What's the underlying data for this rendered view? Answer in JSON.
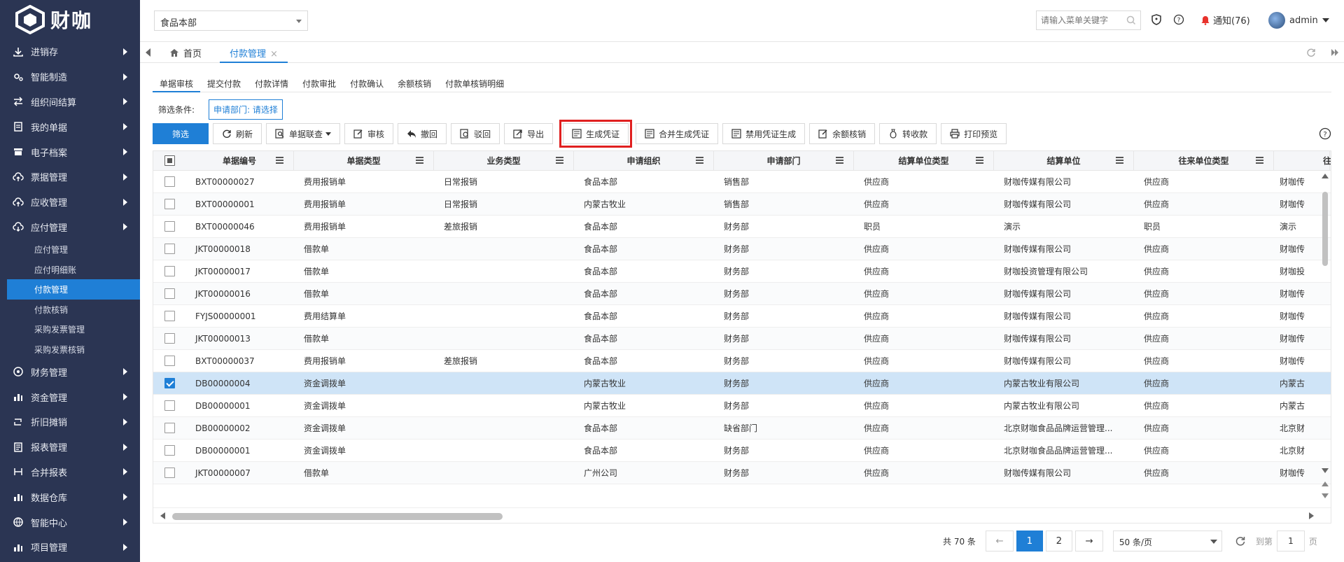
{
  "brand": {
    "name": "财咖"
  },
  "sidebar": {
    "items": [
      {
        "label": "进销存",
        "icon": "download-icon"
      },
      {
        "label": "智能制造",
        "icon": "cogs-icon"
      },
      {
        "label": "组织间结算",
        "icon": "exchange-icon"
      },
      {
        "label": "我的单据",
        "icon": "clipboard-icon"
      },
      {
        "label": "电子档案",
        "icon": "archive-icon"
      },
      {
        "label": "票据管理",
        "icon": "cloud-upload-icon"
      },
      {
        "label": "应收管理",
        "icon": "cloud-upload-icon"
      },
      {
        "label": "应付管理",
        "icon": "cloud-download-icon"
      }
    ],
    "sub_items": [
      {
        "label": "应付管理"
      },
      {
        "label": "应付明细账"
      },
      {
        "label": "付款管理"
      },
      {
        "label": "付款核销"
      },
      {
        "label": "采购发票管理"
      },
      {
        "label": "采购发票核销"
      }
    ],
    "items_after": [
      {
        "label": "财务管理",
        "icon": "finance-icon"
      },
      {
        "label": "资金管理",
        "icon": "bar-chart-icon"
      },
      {
        "label": "折旧摊销",
        "icon": "retweet-icon"
      },
      {
        "label": "报表管理",
        "icon": "report-icon"
      },
      {
        "label": "合并报表",
        "icon": "merge-icon"
      },
      {
        "label": "数据仓库",
        "icon": "bar-chart-icon"
      },
      {
        "label": "智能中心",
        "icon": "globe-icon"
      },
      {
        "label": "项目管理",
        "icon": "bar-chart-icon"
      }
    ]
  },
  "header": {
    "org_select": "食品本部",
    "search_placeholder": "请输入菜单关键字",
    "notice_label": "通知(76)",
    "user_name": "admin"
  },
  "tabs": {
    "home": "首页",
    "active": "付款管理",
    "close": "×"
  },
  "subtabs": [
    "单据审核",
    "提交付款",
    "付款详情",
    "付款审批",
    "付款确认",
    "余额核销",
    "付款单核销明细"
  ],
  "filter": {
    "label": "筛选条件:",
    "chip": "申请部门: 请选择"
  },
  "toolbar": {
    "filter": "筛选",
    "refresh": "刷新",
    "linked": "单据联查",
    "audit": "审核",
    "withdraw": "撤回",
    "reject": "驳回",
    "export": "导出",
    "gen_voucher": "生成凭证",
    "merge_voucher": "合并生成凭证",
    "disable_voucher": "禁用凭证生成",
    "balance_writeoff": "余额核销",
    "transfer": "转收款",
    "print_preview": "打印预览"
  },
  "table": {
    "columns": [
      "单据编号",
      "单据类型",
      "业务类型",
      "申请组织",
      "申请部门",
      "结算单位类型",
      "结算单位",
      "往来单位类型",
      "往"
    ],
    "rows": [
      [
        "BXT00000027",
        "费用报销单",
        "日常报销",
        "食品本部",
        "销售部",
        "供应商",
        "财咖传媒有限公司",
        "供应商",
        "财咖传"
      ],
      [
        "BXT00000001",
        "费用报销单",
        "日常报销",
        "内蒙古牧业",
        "销售部",
        "供应商",
        "财咖传媒有限公司",
        "供应商",
        "财咖传"
      ],
      [
        "BXT00000046",
        "费用报销单",
        "差旅报销",
        "食品本部",
        "财务部",
        "职员",
        "演示",
        "职员",
        "演示"
      ],
      [
        "JKT00000018",
        "借款单",
        "",
        "食品本部",
        "财务部",
        "供应商",
        "财咖传媒有限公司",
        "供应商",
        "财咖传"
      ],
      [
        "JKT00000017",
        "借款单",
        "",
        "食品本部",
        "财务部",
        "供应商",
        "财咖投资管理有限公司",
        "供应商",
        "财咖投"
      ],
      [
        "JKT00000016",
        "借款单",
        "",
        "食品本部",
        "财务部",
        "供应商",
        "财咖传媒有限公司",
        "供应商",
        "财咖传"
      ],
      [
        "FYJS00000001",
        "费用结算单",
        "",
        "食品本部",
        "财务部",
        "供应商",
        "财咖传媒有限公司",
        "供应商",
        "财咖传"
      ],
      [
        "JKT00000013",
        "借款单",
        "",
        "食品本部",
        "财务部",
        "供应商",
        "财咖传媒有限公司",
        "供应商",
        "财咖传"
      ],
      [
        "BXT00000037",
        "费用报销单",
        "差旅报销",
        "食品本部",
        "财务部",
        "供应商",
        "财咖传媒有限公司",
        "供应商",
        "财咖传"
      ],
      [
        "DB00000004",
        "资金调拨单",
        "",
        "内蒙古牧业",
        "财务部",
        "供应商",
        "内蒙古牧业有限公司",
        "供应商",
        "内蒙古"
      ],
      [
        "DB00000001",
        "资金调拨单",
        "",
        "内蒙古牧业",
        "财务部",
        "供应商",
        "内蒙古牧业有限公司",
        "供应商",
        "内蒙古"
      ],
      [
        "DB00000002",
        "资金调拨单",
        "",
        "食品本部",
        "缺省部门",
        "供应商",
        "北京财咖食品品牌运营管理...",
        "供应商",
        "北京财"
      ],
      [
        "DB00000001",
        "资金调拨单",
        "",
        "食品本部",
        "财务部",
        "供应商",
        "北京财咖食品品牌运营管理...",
        "供应商",
        "北京财"
      ],
      [
        "JKT00000007",
        "借款单",
        "",
        "广州公司",
        "财务部",
        "供应商",
        "财咖传媒有限公司",
        "供应商",
        "财咖传"
      ]
    ],
    "selected_row": 9
  },
  "pager": {
    "total": "共 70 条",
    "prev": "←",
    "next": "→",
    "page1": "1",
    "page2": "2",
    "page_size": "50 条/页",
    "goto_label": "到第",
    "goto_value": "1",
    "goto_suffix": "页"
  },
  "colors": {
    "sidebar_bg": "#2b3553",
    "accent": "#1f7fd6",
    "highlight": "#e02020"
  }
}
